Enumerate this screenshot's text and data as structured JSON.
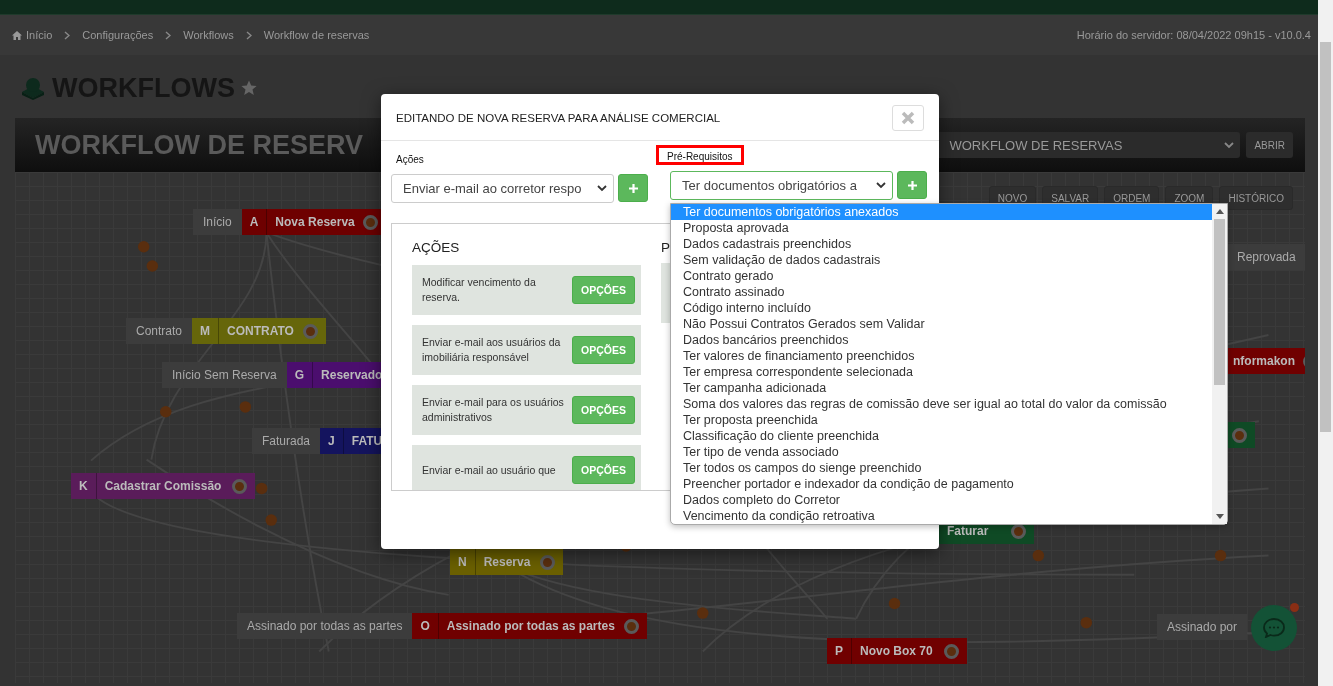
{
  "breadcrumb": [
    {
      "label": "Início"
    },
    {
      "label": "Configurações"
    },
    {
      "label": "Workflows"
    },
    {
      "label": "Workflow de reservas"
    }
  ],
  "server_time": "Horário do servidor: 08/04/2022 09h15 - v10.0.4",
  "page_title": "WORKFLOWS",
  "workflow": {
    "title": "WORKFLOW DE RESERV",
    "select_value": "WORKFLOW DE RESERVAS",
    "open_button": "ABRIR",
    "toolbar": [
      "NOVO",
      "SALVAR",
      "ORDEM",
      "ZOOM",
      "HISTÓRICO"
    ]
  },
  "nodes": [
    {
      "tag": "Início",
      "letter": "A",
      "name": "Nova Reserva",
      "color": "#6e0000"
    },
    {
      "tag": "Contrato",
      "letter": "M",
      "name": "CONTRATO",
      "color": "#66660a"
    },
    {
      "tag": "Início Sem Reserva",
      "letter": "G",
      "name": "Reservado",
      "color": "#4b0e6e"
    },
    {
      "tag": "Faturada",
      "letter": "J",
      "name": "FATU",
      "color": "#14145e"
    },
    {
      "letter": "K",
      "name": "Cadastrar Comissão",
      "color": "#5a1c5a"
    },
    {
      "letter": "N",
      "name": "Reserva",
      "color": "#6b6000"
    },
    {
      "tag": "Assinado por todas as partes",
      "letter": "O",
      "name": "Assinado por todas as partes",
      "color": "#700000"
    },
    {
      "letter": "P",
      "name": "Novo Box 70",
      "color": "#700000"
    },
    {
      "tag": "Reprovada"
    },
    {
      "name": "nformakon",
      "color": "#700000"
    },
    {
      "color": "#0f4a25"
    },
    {
      "name": "Faturar",
      "color": "#0f4a25"
    },
    {
      "tag": "Assinado por"
    }
  ],
  "modal": {
    "title": "EDITANDO DE NOVA RESERVA PARA ANÁLISE COMERCIAL",
    "actions_field": {
      "label": "Ações",
      "value": "Enviar e-mail ao corretor respo"
    },
    "prereq_field": {
      "label": "Pré-Requisitos",
      "value": "Ter documentos obrigatórios a",
      "highlighted": true
    },
    "actions_heading": "AÇÕES",
    "actions": [
      {
        "text": "Modificar vencimento da reserva.",
        "button": "OPÇÕES"
      },
      {
        "text": "Enviar e-mail aos usuários da imobiliária responsável",
        "button": "OPÇÕES"
      },
      {
        "text": "Enviar e-mail para os usuários administrativos",
        "button": "OPÇÕES"
      },
      {
        "text": "Enviar e-mail ao usuário que",
        "button": "OPÇÕES"
      }
    ],
    "prereq_heading": "P"
  },
  "dropdown": [
    {
      "label": "Ter documentos obrigatórios anexados",
      "selected": true
    },
    {
      "label": "Proposta aprovada",
      "selected": false
    },
    {
      "label": "Dados cadastrais preenchidos",
      "selected": false
    },
    {
      "label": "Sem validação de dados cadastrais",
      "selected": false
    },
    {
      "label": "Contrato gerado",
      "selected": false
    },
    {
      "label": "Contrato assinado",
      "selected": false
    },
    {
      "label": "Código interno incluído",
      "selected": false
    },
    {
      "label": "Não Possui Contratos Gerados sem Validar",
      "selected": false
    },
    {
      "label": "Dados bancários preenchidos",
      "selected": false
    },
    {
      "label": "Ter valores de financiamento preenchidos",
      "selected": false
    },
    {
      "label": "Ter empresa correspondente selecionada",
      "selected": false
    },
    {
      "label": "Ter campanha adicionada",
      "selected": false
    },
    {
      "label": "Soma dos valores das regras de comissão deve ser igual ao total do valor da comissão",
      "selected": false
    },
    {
      "label": "Ter proposta preenchida",
      "selected": false
    },
    {
      "label": "Classificação do cliente preenchida",
      "selected": false
    },
    {
      "label": "Ter tipo de venda associado",
      "selected": false
    },
    {
      "label": "Ter todos os campos do sienge preenchido",
      "selected": false
    },
    {
      "label": "Preencher portador e indexador da condição de pagamento",
      "selected": false
    },
    {
      "label": "Dados completo do Corretor",
      "selected": false
    },
    {
      "label": "Vencimento da condição retroativa",
      "selected": false
    }
  ]
}
